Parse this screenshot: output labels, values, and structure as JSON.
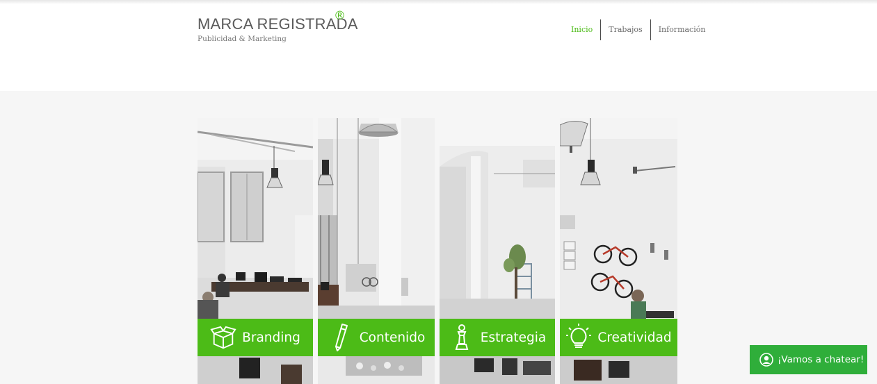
{
  "brand": {
    "title": "MARCA REGISTRADA",
    "registered_mark": "®",
    "subtitle": "Publicidad & Marketing"
  },
  "nav": {
    "items": [
      {
        "label": "Inicio",
        "active": true
      },
      {
        "label": "Trabajos",
        "active": false
      },
      {
        "label": "Información",
        "active": false
      }
    ]
  },
  "services": [
    {
      "label": "Branding",
      "icon": "open-box-icon"
    },
    {
      "label": "Contenido",
      "icon": "pencil-icon"
    },
    {
      "label": "Estrategia",
      "icon": "chess-pawn-icon"
    },
    {
      "label": "Creatividad",
      "icon": "lightbulb-icon"
    }
  ],
  "chat": {
    "label": "¡Vamos a chatear!",
    "icon": "user-avatar-icon"
  },
  "colors": {
    "accent": "#4cbb17",
    "chat_bg": "#2fae3a",
    "page_bg": "#f6f6f6",
    "header_bg": "#ffffff"
  }
}
